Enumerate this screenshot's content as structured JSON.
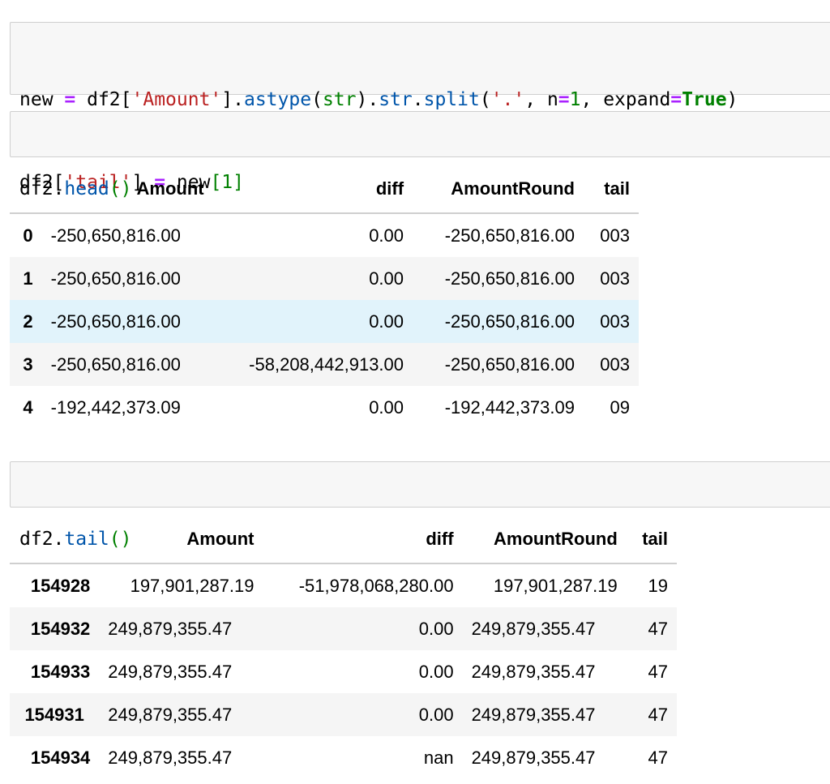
{
  "cells": {
    "cell1_line1": [
      {
        "t": "new ",
        "c": "t-var"
      },
      {
        "t": "=",
        "c": "t-op"
      },
      {
        "t": " df2[",
        "c": "t-var"
      },
      {
        "t": "'Amount'",
        "c": "t-str"
      },
      {
        "t": "].",
        "c": "t-var"
      },
      {
        "t": "astype",
        "c": "t-fn"
      },
      {
        "t": "(",
        "c": "t-var"
      },
      {
        "t": "str",
        "c": "t-num"
      },
      {
        "t": ").",
        "c": "t-var"
      },
      {
        "t": "str",
        "c": "t-fn"
      },
      {
        "t": ".",
        "c": "t-var"
      },
      {
        "t": "split",
        "c": "t-fn"
      },
      {
        "t": "(",
        "c": "t-var"
      },
      {
        "t": "'.'",
        "c": "t-str"
      },
      {
        "t": ", n",
        "c": "t-var"
      },
      {
        "t": "=",
        "c": "t-op"
      },
      {
        "t": "1",
        "c": "t-num"
      },
      {
        "t": ", expand",
        "c": "t-var"
      },
      {
        "t": "=",
        "c": "t-op"
      },
      {
        "t": "True",
        "c": "t-kw"
      },
      {
        "t": ")",
        "c": "t-var"
      }
    ],
    "cell1_line2": [
      {
        "t": "df2[",
        "c": "t-var"
      },
      {
        "t": "'tail'",
        "c": "t-str"
      },
      {
        "t": "] ",
        "c": "t-var"
      },
      {
        "t": "=",
        "c": "t-op"
      },
      {
        "t": " new",
        "c": "t-var"
      },
      {
        "t": "[",
        "c": "t-brg"
      },
      {
        "t": "1",
        "c": "t-num"
      },
      {
        "t": "]",
        "c": "t-brg"
      }
    ],
    "cell2_line1": [
      {
        "t": "df2.",
        "c": "t-var"
      },
      {
        "t": "head",
        "c": "t-fn"
      },
      {
        "t": "()",
        "c": "t-brg"
      }
    ],
    "cell3_line1": [
      {
        "t": "df2.",
        "c": "t-var"
      },
      {
        "t": "tail",
        "c": "t-fn"
      },
      {
        "t": "()",
        "c": "t-brg"
      }
    ]
  },
  "head_table": {
    "columns": [
      "Amount",
      "diff",
      "AmountRound",
      "tail"
    ],
    "rows": [
      {
        "index": "0",
        "Amount": "-250,650,816.00",
        "diff": "0.00",
        "AmountRound": "-250,650,816.00",
        "tail": "003"
      },
      {
        "index": "1",
        "Amount": "-250,650,816.00",
        "diff": "0.00",
        "AmountRound": "-250,650,816.00",
        "tail": "003"
      },
      {
        "index": "2",
        "Amount": "-250,650,816.00",
        "diff": "0.00",
        "AmountRound": "-250,650,816.00",
        "tail": "003"
      },
      {
        "index": "3",
        "Amount": "-250,650,816.00",
        "diff": "-58,208,442,913.00",
        "AmountRound": "-250,650,816.00",
        "tail": "003"
      },
      {
        "index": "4",
        "Amount": "-192,442,373.09",
        "diff": "0.00",
        "AmountRound": "-192,442,373.09",
        "tail": "09"
      }
    ]
  },
  "tail_table": {
    "columns": [
      "Amount",
      "diff",
      "AmountRound",
      "tail"
    ],
    "rows": [
      {
        "index": "154928",
        "Amount": "197,901,287.19",
        "diff": "-51,978,068,280.00",
        "AmountRound": "197,901,287.19",
        "tail": "19"
      },
      {
        "index": "154932",
        "Amount": "249,879,355.47",
        "diff": "0.00",
        "AmountRound": "249,879,355.47",
        "tail": "47"
      },
      {
        "index": "154933",
        "Amount": "249,879,355.47",
        "diff": "0.00",
        "AmountRound": "249,879,355.47",
        "tail": "47"
      },
      {
        "index": "154931",
        "Amount": "249,879,355.47",
        "diff": "0.00",
        "AmountRound": "249,879,355.47",
        "tail": "47"
      },
      {
        "index": "154934",
        "Amount": "249,879,355.47",
        "diff": "nan",
        "AmountRound": "249,879,355.47",
        "tail": "47"
      }
    ]
  },
  "colors": {
    "cell_bg": "#f7f7f7",
    "hover_row": "#e1f3fb",
    "string": "#ba2121",
    "function": "#0055aa",
    "operator": "#aa22ff",
    "keyword": "#008000"
  }
}
